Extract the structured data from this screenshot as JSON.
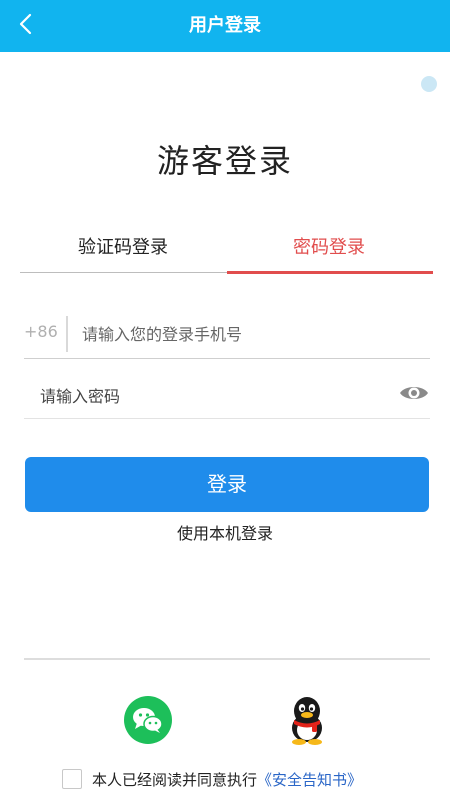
{
  "header": {
    "title": "用户登录",
    "back_icon": "chevron-left-icon",
    "background": "#11b4ef"
  },
  "main": {
    "title": "游客登录"
  },
  "tabs": [
    {
      "label": "验证码登录",
      "active": false
    },
    {
      "label": "密码登录",
      "active": true,
      "color": "#e14d4d"
    }
  ],
  "form": {
    "phone_prefix": "+86",
    "phone_placeholder": "请输入您的登录手机号",
    "phone_value": "",
    "password_placeholder": "请输入密码",
    "password_value": "",
    "eye_icon": "eye-icon"
  },
  "actions": {
    "login_label": "登录",
    "login_color": "#1f8ceb",
    "local_login_label": "使用本机登录"
  },
  "social": [
    {
      "name": "wechat",
      "icon": "wechat-icon",
      "color": "#1dbf5a"
    },
    {
      "name": "qq",
      "icon": "qq-icon"
    }
  ],
  "agreement": {
    "checked": false,
    "text": "本人已经阅读并同意执行",
    "link_label": "《安全告知书》"
  }
}
